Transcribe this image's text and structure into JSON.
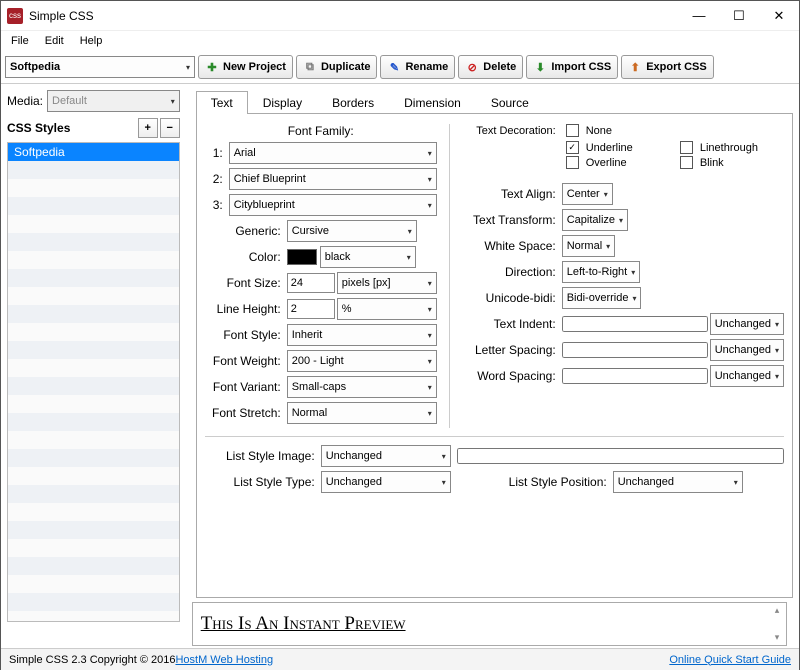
{
  "window": {
    "title": "Simple CSS"
  },
  "menu": {
    "file": "File",
    "edit": "Edit",
    "help": "Help"
  },
  "toolbar": {
    "project": "Softpedia",
    "new": "New Project",
    "dup": "Duplicate",
    "ren": "Rename",
    "del": "Delete",
    "imp": "Import CSS",
    "exp": "Export CSS"
  },
  "sidebar": {
    "media_label": "Media:",
    "media_value": "Default",
    "styles_label": "CSS Styles",
    "selected": "Softpedia"
  },
  "tabs": {
    "text": "Text",
    "display": "Display",
    "borders": "Borders",
    "dimension": "Dimension",
    "source": "Source"
  },
  "font": {
    "family_label": "Font Family:",
    "l1": "1:",
    "v1": "Arial",
    "l2": "2:",
    "v2": "Chief Blueprint",
    "l3": "3:",
    "v3": "Cityblueprint",
    "generic_l": "Generic:",
    "generic_v": "Cursive",
    "color_l": "Color:",
    "color_v": "black",
    "size_l": "Font Size:",
    "size_v": "24",
    "size_u": "pixels [px]",
    "lh_l": "Line Height:",
    "lh_v": "2",
    "lh_u": "%",
    "style_l": "Font Style:",
    "style_v": "Inherit",
    "weight_l": "Font Weight:",
    "weight_v": "200 - Light",
    "variant_l": "Font Variant:",
    "variant_v": "Small-caps",
    "stretch_l": "Font Stretch:",
    "stretch_v": "Normal"
  },
  "deco": {
    "label": "Text Decoration:",
    "none": "None",
    "underline": "Underline",
    "linethrough": "Linethrough",
    "overline": "Overline",
    "blink": "Blink"
  },
  "text": {
    "align_l": "Text Align:",
    "align_v": "Center",
    "trans_l": "Text Transform:",
    "trans_v": "Capitalize",
    "ws_l": "White Space:",
    "ws_v": "Normal",
    "dir_l": "Direction:",
    "dir_v": "Left-to-Right",
    "bidi_l": "Unicode-bidi:",
    "bidi_v": "Bidi-override",
    "indent_l": "Text Indent:",
    "indent_u": "Unchanged",
    "ls_l": "Letter Spacing:",
    "ls_u": "Unchanged",
    "ws2_l": "Word Spacing:",
    "ws2_u": "Unchanged"
  },
  "list": {
    "img_l": "List Style Image:",
    "img_v": "Unchanged",
    "type_l": "List Style Type:",
    "type_v": "Unchanged",
    "pos_l": "List Style Position:",
    "pos_v": "Unchanged"
  },
  "preview": "This Is An Instant Preview",
  "status": {
    "prefix": "Simple CSS 2.3 Copyright © 2016 ",
    "host": "HostM Web Hosting",
    "guide": "Online Quick Start Guide"
  }
}
